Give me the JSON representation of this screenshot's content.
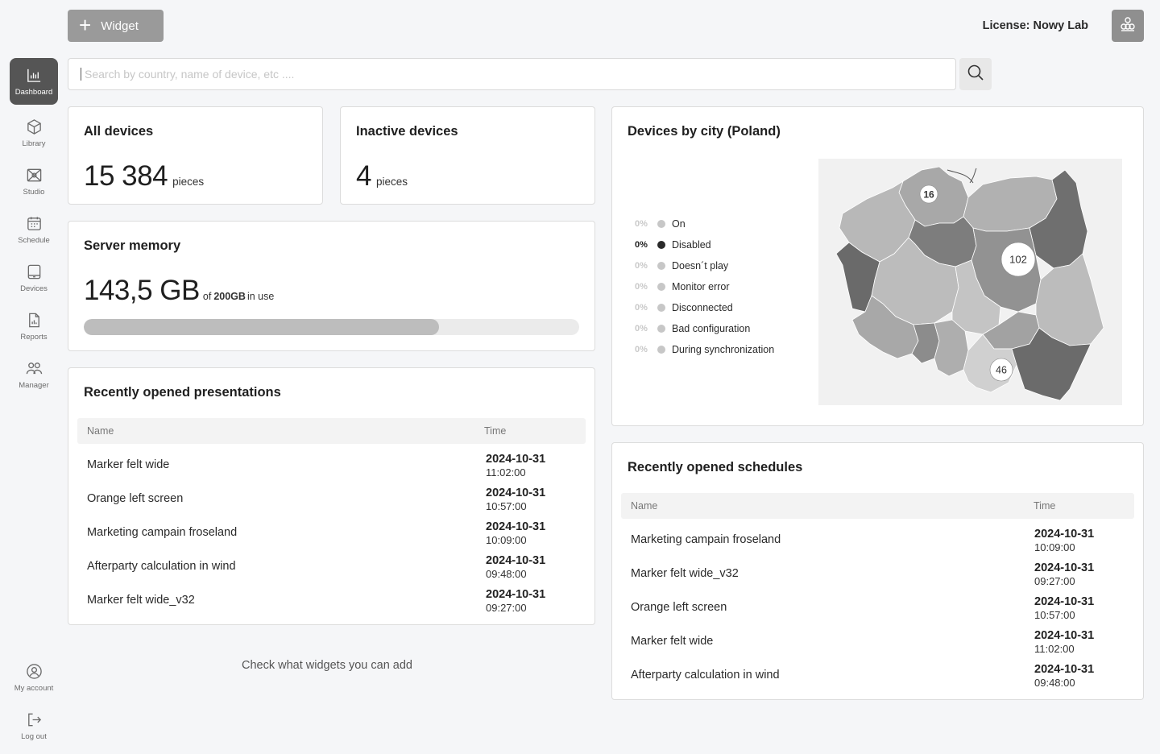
{
  "nav": {
    "items": [
      {
        "label": "Dashboard",
        "icon": "dashboard-icon",
        "active": true
      },
      {
        "label": "Library",
        "icon": "cube-icon"
      },
      {
        "label": "Studio",
        "icon": "studio-icon"
      },
      {
        "label": "Schedule",
        "icon": "calendar-icon"
      },
      {
        "label": "Devices",
        "icon": "tablet-icon"
      },
      {
        "label": "Reports",
        "icon": "report-icon"
      },
      {
        "label": "Manager",
        "icon": "users-icon"
      }
    ],
    "account": {
      "label": "My account",
      "icon": "user-circle-icon"
    },
    "logout": {
      "label": "Log out",
      "icon": "logout-icon"
    }
  },
  "topbar": {
    "widget_label": "Widget",
    "license": "License: Nowy Lab"
  },
  "search": {
    "placeholder": "Search by country, name of device, etc ....",
    "value": ""
  },
  "all_devices": {
    "title": "All devices",
    "value": "15 384",
    "unit": "pieces"
  },
  "inactive_devices": {
    "title": "Inactive devices",
    "value": "4",
    "unit": "pieces"
  },
  "server_memory": {
    "title": "Server memory",
    "value": "143,5 GB",
    "of": "of",
    "total": "200GB",
    "suffix": "in use",
    "used_fraction": 0.7175
  },
  "presentations": {
    "title": "Recently opened presentations",
    "col_name": "Name",
    "col_time": "Time",
    "rows": [
      {
        "name": "Marker felt wide",
        "date": "2024-10-31",
        "time": "11:02:00"
      },
      {
        "name": "Orange left screen",
        "date": "2024-10-31",
        "time": "10:57:00"
      },
      {
        "name": "Marketing campain froseland",
        "date": "2024-10-31",
        "time": "10:09:00"
      },
      {
        "name": "Afterparty calculation in wind",
        "date": "2024-10-31",
        "time": "09:48:00"
      },
      {
        "name": "Marker felt wide_v32",
        "date": "2024-10-31",
        "time": "09:27:00"
      }
    ]
  },
  "map": {
    "title": "Devices by city (Poland)",
    "legend": [
      {
        "pct": "0%",
        "label": "On"
      },
      {
        "pct": "0%",
        "label": "Disabled",
        "highlight": true
      },
      {
        "pct": "0%",
        "label": "Doesn´t play"
      },
      {
        "pct": "0%",
        "label": "Monitor error"
      },
      {
        "pct": "0%",
        "label": "Disconnected"
      },
      {
        "pct": "0%",
        "label": "Bad configuration"
      },
      {
        "pct": "0%",
        "label": "During synchronization"
      }
    ],
    "markers": [
      "16",
      "102",
      "46"
    ]
  },
  "schedules": {
    "title": "Recently opened schedules",
    "col_name": "Name",
    "col_time": "Time",
    "rows": [
      {
        "name": "Marketing campain froseland",
        "date": "2024-10-31",
        "time": "10:09:00"
      },
      {
        "name": "Marker felt wide_v32",
        "date": "2024-10-31",
        "time": "09:27:00"
      },
      {
        "name": "Orange left screen",
        "date": "2024-10-31",
        "time": "10:57:00"
      },
      {
        "name": "Marker felt wide",
        "date": "2024-10-31",
        "time": "11:02:00"
      },
      {
        "name": "Afterparty calculation in wind",
        "date": "2024-10-31",
        "time": "09:48:00"
      }
    ]
  },
  "footer": {
    "add_widgets_link": "Check what widgets you can add"
  }
}
